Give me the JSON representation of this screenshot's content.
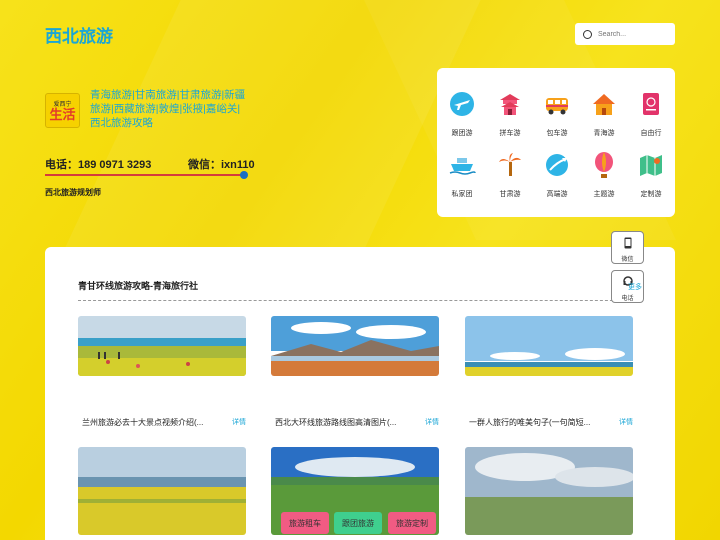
{
  "header": {
    "site_title": "西北旅游",
    "search_placeholder": "Search..."
  },
  "profile": {
    "logo_top": "爱西宁",
    "logo_main": "生活",
    "intro": "青海旅游|甘南旅游|甘肃旅游|新疆旅游|西藏旅游|敦煌|张掖|嘉峪关|西北旅游攻略",
    "phone": "电话：189 0971 3293",
    "wechat": "微信：ixn110",
    "planner": "西北旅游规划师"
  },
  "icons": [
    {
      "label": "跟团游",
      "icon": "airplane-icon"
    },
    {
      "label": "拼车游",
      "icon": "temple-icon"
    },
    {
      "label": "包车游",
      "icon": "bus-icon"
    },
    {
      "label": "青海游",
      "icon": "house-icon"
    },
    {
      "label": "自由行",
      "icon": "passport-icon"
    },
    {
      "label": "私家团",
      "icon": "cruise-ship-icon"
    },
    {
      "label": "甘肃游",
      "icon": "palm-tree-icon"
    },
    {
      "label": "高端游",
      "icon": "globe-icon"
    },
    {
      "label": "主题游",
      "icon": "hot-air-balloon-icon"
    },
    {
      "label": "定制游",
      "icon": "map-icon"
    }
  ],
  "section": {
    "title": "青甘环线旅游攻略-青海旅行社"
  },
  "side_buttons": {
    "wechat": "微信",
    "phone": "电话",
    "more": "更多"
  },
  "articles": [
    {
      "title": "兰州旅游必去十大景点视频介绍(...",
      "more": "详情"
    },
    {
      "title": "西北大环线旅游路线图高清图片(...",
      "more": "详情"
    },
    {
      "title": "一群人旅行的唯美句子(一句简短...",
      "more": "详情"
    }
  ],
  "bottom_tags": [
    {
      "label": "旅游租车",
      "color": "#f15b83"
    },
    {
      "label": "跟团旅游",
      "color": "#3fcf8e"
    },
    {
      "label": "旅游定制",
      "color": "#f15b83"
    }
  ],
  "colors": {
    "accent": "#1aa6d6",
    "background": "#f3d800",
    "line": "#d43c3c"
  }
}
